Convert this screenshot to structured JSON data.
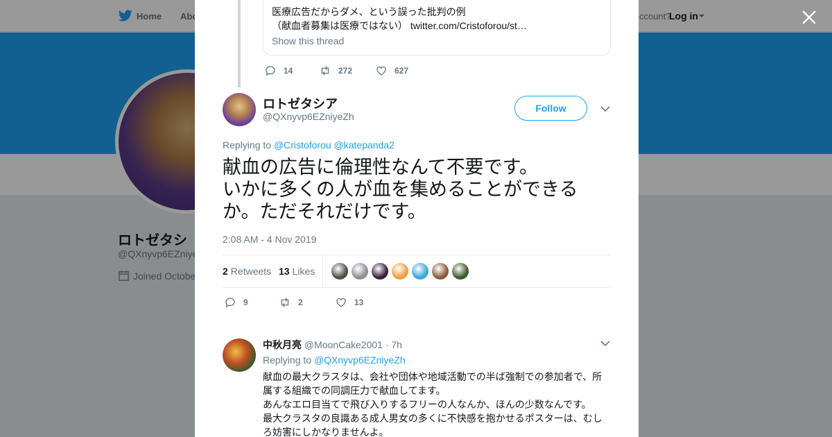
{
  "nav": {
    "home": "Home",
    "about": "Abo",
    "account_prompt": "ccount?",
    "login": "Log in"
  },
  "profile": {
    "name": "ロトゼタシ",
    "handle": "@QXnyvp6EZniye",
    "joined": "Joined Octobe"
  },
  "quoted_tweet": {
    "line1": "医療広告だからダメ、という誤った批判の例",
    "line2_text": "（献血者募集は医療ではない）",
    "line2_link": "twitter.com/Cristoforou/st…",
    "show_thread": "Show this thread"
  },
  "parent_actions": {
    "replies": "14",
    "retweets": "272",
    "likes": "627"
  },
  "tweet": {
    "author_name": "ロトゼタシア",
    "author_handle": "@QXnyvp6EZniyeZh",
    "follow_label": "Follow",
    "replying_prefix": "Replying to",
    "mention1": "@Cristoforou",
    "mention2": "@katepanda2",
    "text_lines": [
      "献血の広告に倫理性なんて不要です。",
      "いかに多くの人が血を集めることができる",
      "か。ただそれだけです。"
    ],
    "timestamp": "2:08 AM - 4 Nov 2019",
    "retweet_count": "2",
    "retweet_label": "Retweets",
    "like_count": "13",
    "like_label": "Likes",
    "likers": [
      {
        "color": "#4a4f45"
      },
      {
        "color": "#8d8f95"
      },
      {
        "color": "#3a1f3a"
      },
      {
        "color": "#f0a040"
      },
      {
        "color": "#3aa6d8"
      },
      {
        "color": "#8a5a3a"
      },
      {
        "color": "#3d5a2a"
      }
    ],
    "actions": {
      "replies": "9",
      "retweets": "2",
      "likes": "13"
    }
  },
  "reply": {
    "name": "中秋月亮",
    "handle": "@MoonCake2001",
    "time": "· 7h",
    "replying_prefix": "Replying to",
    "mention": "@QXnyvp6EZniyeZh",
    "text_lines": [
      "献血の最大クラスタは、会社や団体や地域活動での半ば強制での参加者で、所",
      "属する組織での同調圧力で献血してます。",
      "あんなエロ目当てで飛び入りするフリーの人なんか、ほんの少数なんです。",
      "最大クラスタの良識ある成人男女の多くに不快感を抱かせるポスターは、むし",
      "ろ妨害にしかなりませんよ。"
    ]
  },
  "colors": {
    "accent": "#1da1f2",
    "text": "#14171a",
    "muted": "#657786"
  }
}
